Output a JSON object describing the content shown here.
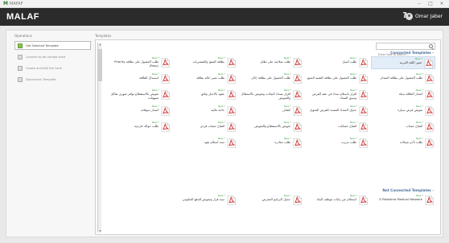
{
  "window": {
    "title": "MAFAF",
    "min": "–",
    "max": "□",
    "close": "×"
  },
  "header": {
    "brand": "MALAF",
    "help": "?",
    "user": "Omar Jaber"
  },
  "operations": {
    "title": "Operations",
    "items": [
      {
        "label": "Get Selected Template",
        "active": true
      },
      {
        "label": "Connect to be Unread seed",
        "active": false
      },
      {
        "label": "Create and Edit the Form",
        "active": false
      },
      {
        "label": "Disconnect Template",
        "active": false
      }
    ]
  },
  "templates": {
    "title": "Templates",
    "search_placeholder": "Enter text to search...",
    "new_label": "New *",
    "connected_title": "Connected Templates -",
    "not_connected_title": "Not Connected Templates -",
    "connected": [
      {
        "label": "تغيير اللغة العربية",
        "highlight": true
      },
      {
        "label": "طلب أصيل"
      },
      {
        "label": "طلب صلاحية على نظام"
      },
      {
        "label": "بطاقة المنتج والمشتريات"
      },
      {
        "label": "طلب الحصول على بطاقة Priority (Pass)"
      },
      {
        "label": "طلب الحصول على بطاقة المتدان"
      },
      {
        "label": "طلب الحصول على بطاقة التقنية المتبع"
      },
      {
        "label": "طلب الحصول على بطاقة (كان"
      },
      {
        "label": "طلب تغيير حالة بطاقة"
      },
      {
        "label": "استبدال الطاقة"
      },
      {
        "label": "اصدار الطاقة بديلة"
      },
      {
        "label": "اقرار باستلام سداد في عقد القرض وسبق السداد"
      },
      {
        "label": "اقرار بسداد البيانات وتعويض بالاستقلال والتعويض"
      },
      {
        "label": "عقود بالاجبار وثائق"
      },
      {
        "label": "تعويض بالاستقطاع نوافر شهري تفاكل تسهيلات"
      },
      {
        "label": "تعويض قرض سيارة"
      },
      {
        "label": "جدول السداد المسدد للقرض التحويل"
      },
      {
        "label": "كشاف"
      },
      {
        "label": "حاجة مالية"
      },
      {
        "label": "اصدار سوفانة"
      },
      {
        "label": "افتتاح حساب"
      },
      {
        "label": "افتتاح حسابات"
      },
      {
        "label": "تعويض بالاستقطاع والتعويض"
      },
      {
        "label": "افتتاح حساب فردي"
      },
      {
        "label": "طلب حوالة خارجية"
      },
      {
        "label": "طلب تأخر شيكات"
      },
      {
        "label": "طلب تدريب"
      },
      {
        "label": "طلب مغادرة"
      },
      {
        "label": "سند استلام نقود"
      }
    ],
    "not_connected": [
      {
        "label": "E-Palestine Medical Network"
      },
      {
        "label": "استعلام عن بيانات موظف البنك"
      },
      {
        "label": "جدول البرامج المعرض"
      },
      {
        "label": "سند قرار وتعويض للدفع الحكومي"
      }
    ]
  },
  "colors": {
    "header": "#2b2b2b",
    "accent": "#4a6f9e",
    "new_badge": "#43a047",
    "pdf_red": "#d32f2f"
  }
}
